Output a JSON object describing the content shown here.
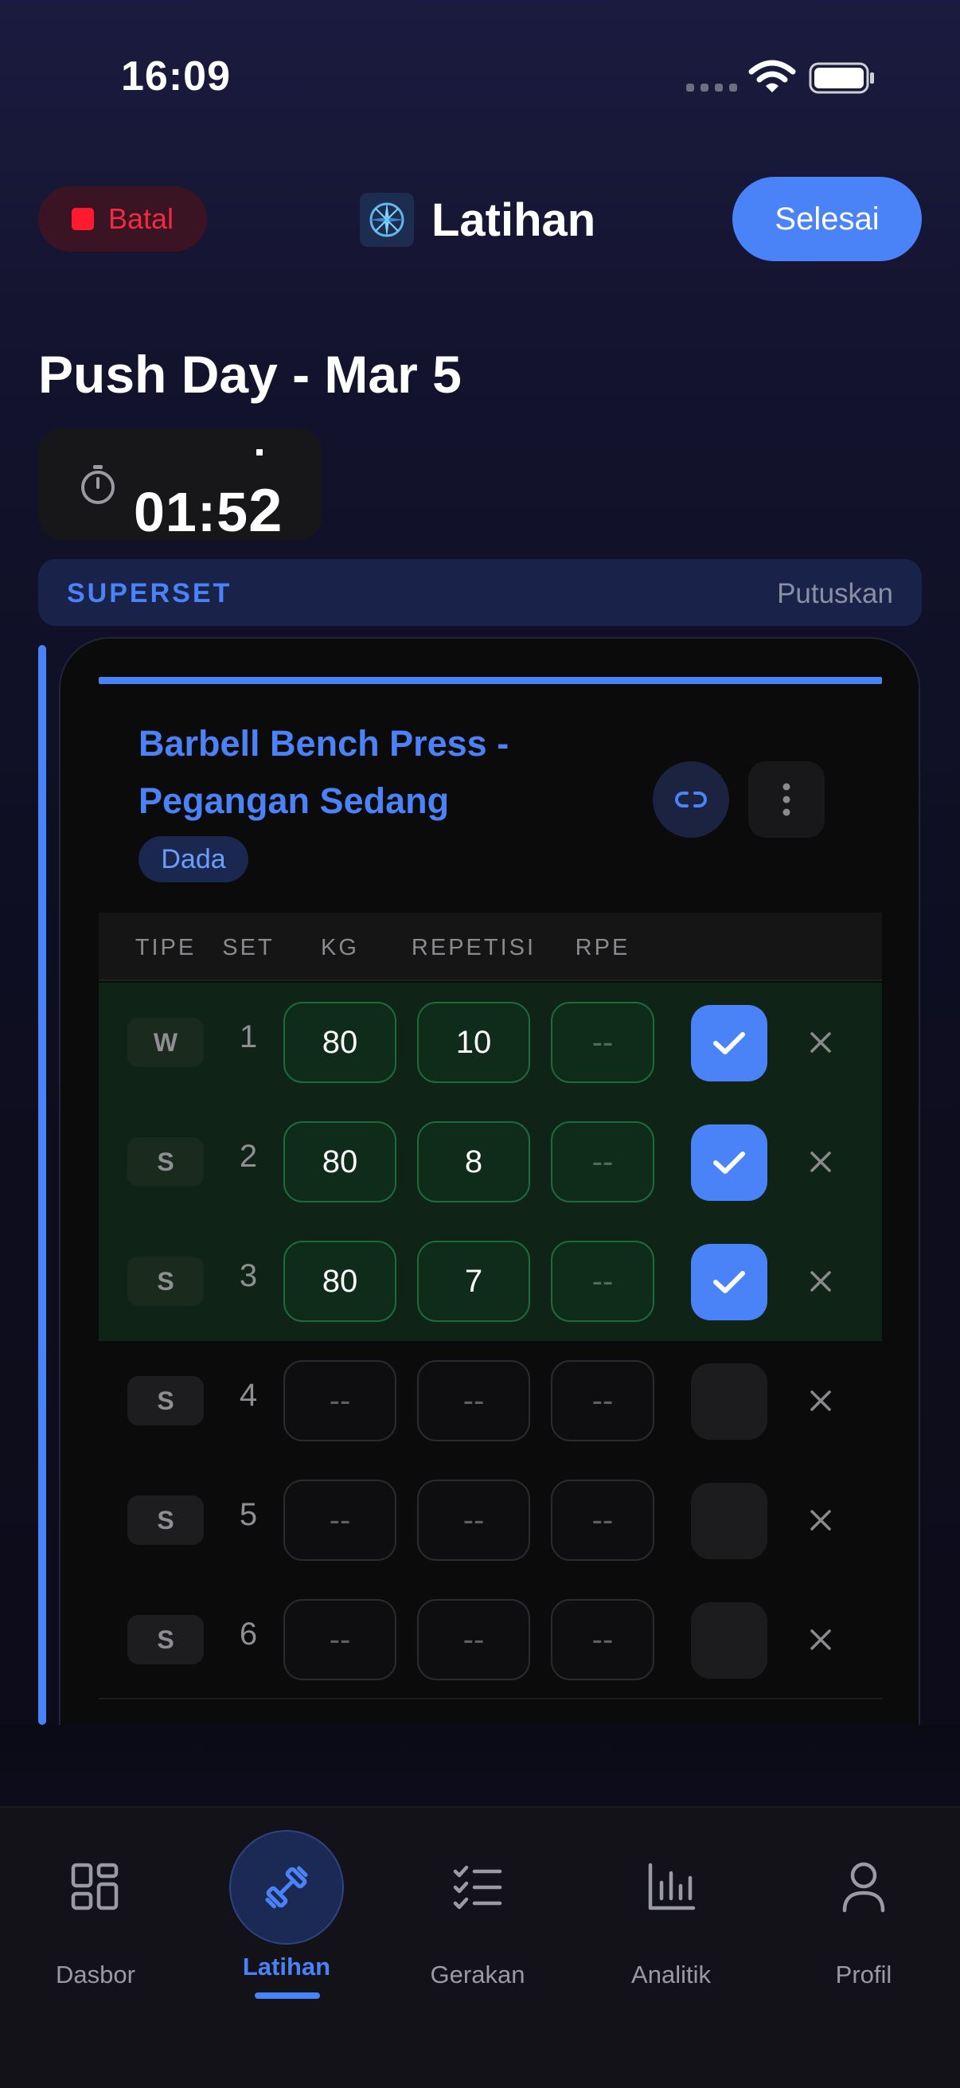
{
  "status_bar": {
    "time": "16:09"
  },
  "header": {
    "cancel_label": "Batal",
    "title": "Latihan",
    "done_label": "Selesai"
  },
  "workout": {
    "name": "Push Day - Mar 5",
    "timer_main": "01:5",
    "timer_sub": "2"
  },
  "superset": {
    "label": "SUPERSET",
    "break_label": "Putuskan"
  },
  "exercise": {
    "name": "Barbell Bench Press - Pegangan Sedang",
    "muscle_tag": "Dada",
    "columns": [
      "TIPE",
      "SET",
      "KG",
      "REPETISI",
      "RPE"
    ],
    "sets": [
      {
        "type": "W",
        "set": "1",
        "kg": "80",
        "reps": "10",
        "rpe": "--",
        "completed": true
      },
      {
        "type": "S",
        "set": "2",
        "kg": "80",
        "reps": "8",
        "rpe": "--",
        "completed": true
      },
      {
        "type": "S",
        "set": "3",
        "kg": "80",
        "reps": "7",
        "rpe": "--",
        "completed": true
      },
      {
        "type": "S",
        "set": "4",
        "kg": "--",
        "reps": "--",
        "rpe": "--",
        "completed": false
      },
      {
        "type": "S",
        "set": "5",
        "kg": "--",
        "reps": "--",
        "rpe": "--",
        "completed": false
      },
      {
        "type": "S",
        "set": "6",
        "kg": "--",
        "reps": "--",
        "rpe": "--",
        "completed": false
      }
    ]
  },
  "tabs": [
    {
      "label": "Dasbor",
      "icon": "dashboard-icon",
      "active": false
    },
    {
      "label": "Latihan",
      "icon": "dumbbell-icon",
      "active": true
    },
    {
      "label": "Gerakan",
      "icon": "checklist-icon",
      "active": false
    },
    {
      "label": "Analitik",
      "icon": "bar-chart-icon",
      "active": false
    },
    {
      "label": "Profil",
      "icon": "person-icon",
      "active": false
    }
  ],
  "colors": {
    "accent": "#4a83f7",
    "cancel": "#ef2b3f",
    "completed_row": "#0f2416",
    "completed_cell_border": "#1c6b3b"
  }
}
